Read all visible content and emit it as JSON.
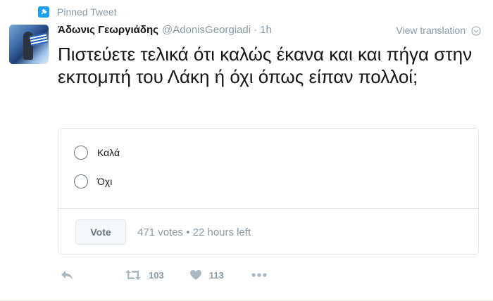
{
  "pinned": {
    "label": "Pinned Tweet",
    "icon": "pin-icon"
  },
  "author": {
    "fullname": "Άδωνις Γεωργιάδης",
    "username": "@AdonisGeorgiadi",
    "separator": "·",
    "time": "1h"
  },
  "view_translation": "View translation",
  "tweet_text": "Πιστεύετε τελικά ότι καλώς έκανα και και πήγα στην εκπομπή του Λάκη ή όχι όπως είπαν πολλοί;",
  "poll": {
    "options": [
      {
        "label": "Καλά"
      },
      {
        "label": "Όχι"
      }
    ],
    "vote_label": "Vote",
    "meta": "471 votes • 22 hours left"
  },
  "actions": {
    "retweet_count": "103",
    "like_count": "113"
  },
  "colors": {
    "accent": "#1da1f2",
    "muted": "#8899a6",
    "border": "#e1e8ed",
    "text": "#14171a"
  }
}
